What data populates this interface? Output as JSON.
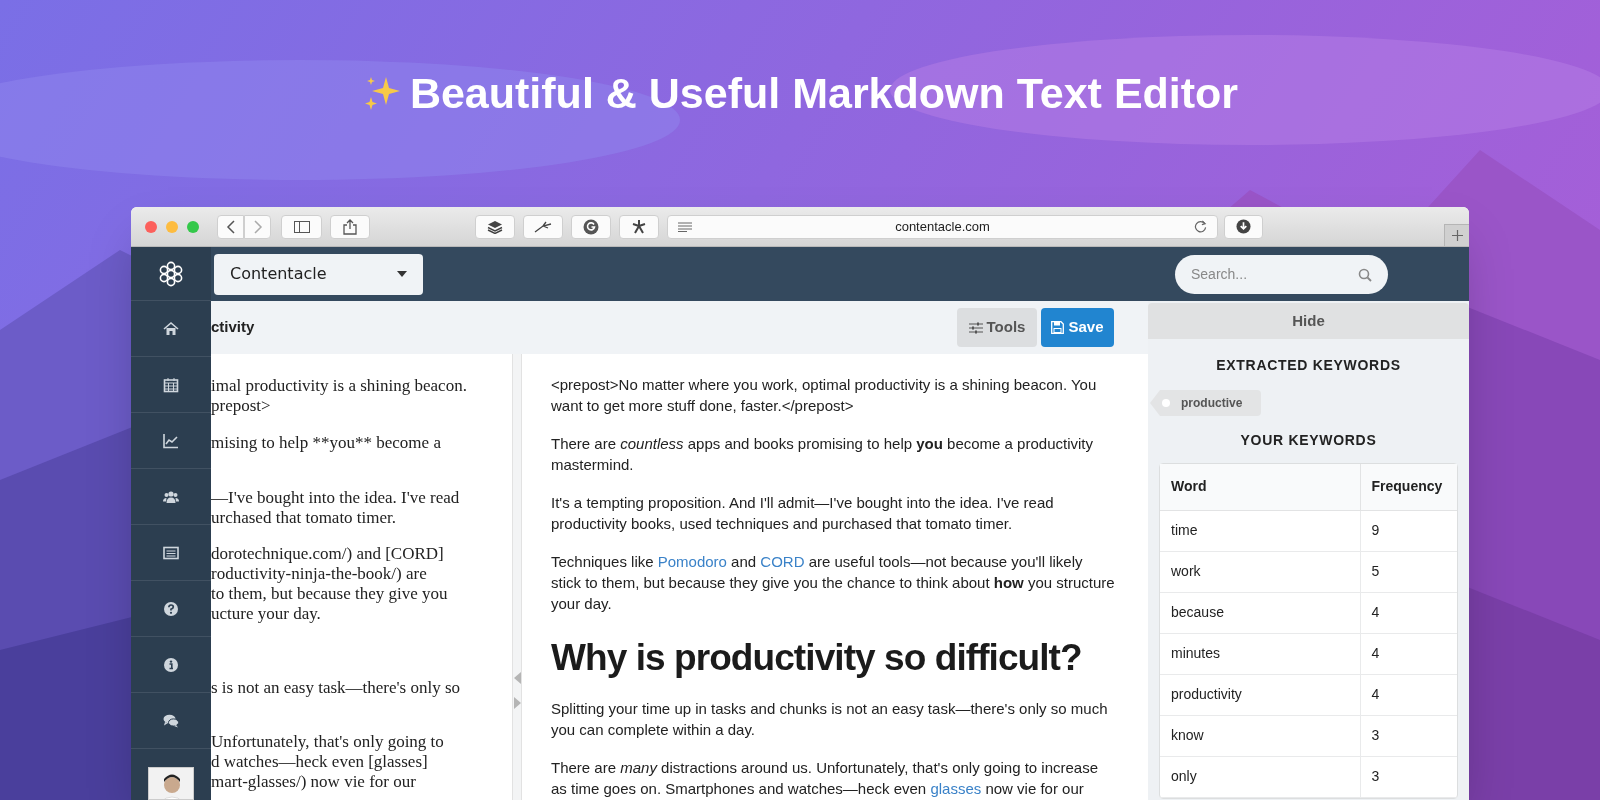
{
  "headline": "Beautiful & Useful Markdown Text Editor",
  "browser": {
    "url": "contentacle.com"
  },
  "app": {
    "workspace": "Contentacle",
    "search_placeholder": "Search...",
    "sidebar_items": [
      {
        "kind": "home"
      },
      {
        "kind": "calendar"
      },
      {
        "kind": "chart"
      },
      {
        "kind": "users"
      },
      {
        "kind": "list"
      },
      {
        "kind": "help"
      },
      {
        "kind": "info"
      },
      {
        "kind": "chat"
      }
    ],
    "document_title": "ctivity",
    "tools_button": "Tools",
    "save_button": "Save",
    "source_paragraphs": [
      [
        "imal productivity is a shining beacon.",
        "prepost>"
      ],
      [
        "mising to help **you** become a"
      ],
      [
        "—I've bought into the idea. I've read",
        "urchased that tomato timer."
      ],
      [
        "dorotechnique.com/) and [CORD]",
        "roductivity-ninja-the-book/) are",
        "to them, but because they give you",
        "ucture your day."
      ],
      [
        "s is not an easy task—there's only so"
      ],
      [
        "Unfortunately, that's only going to",
        "d watches—heck even [glasses]",
        "mart-glasses/) now vie for our"
      ]
    ],
    "preview": [
      {
        "kind": "paragraph",
        "segments": [
          {
            "kind": "text",
            "text": "<prepost>No matter where you work, optimal productivity is a shining beacon. You want to get more stuff done, faster.</prepost>"
          }
        ]
      },
      {
        "kind": "paragraph",
        "segments": [
          {
            "kind": "text",
            "text": "There are *countless* apps and books promising to help **you** become a productivity mastermind."
          }
        ]
      },
      {
        "kind": "paragraph",
        "segments": [
          {
            "kind": "text",
            "text": "It's a tempting proposition. And I'll admit—I've bought into the idea. I've read productivity books, used techniques and purchased that tomato timer."
          }
        ]
      },
      {
        "kind": "paragraph",
        "segments": [
          {
            "kind": "text",
            "text": "Techniques like "
          },
          {
            "kind": "link",
            "text": "Pomodoro"
          },
          {
            "kind": "text",
            "text": " and "
          },
          {
            "kind": "link",
            "text": "CORD"
          },
          {
            "kind": "text",
            "text": " are useful tools—not because you'll likely stick to them, but because they give you the chance to think about **how** you structure your day."
          }
        ]
      },
      {
        "kind": "heading",
        "segments": [
          {
            "kind": "text",
            "text": "Why is productivity so difficult?"
          }
        ]
      },
      {
        "kind": "paragraph",
        "segments": [
          {
            "kind": "text",
            "text": "Splitting your time up in tasks and chunks is not an easy task—there's only so much you can complete within a day."
          }
        ]
      },
      {
        "kind": "paragraph",
        "segments": [
          {
            "kind": "text",
            "text": "There are *many* distractions around us. Unfortunately, that's only going to increase as time goes on. Smartphones and watches—heck even "
          },
          {
            "kind": "link",
            "text": "glasses"
          },
          {
            "kind": "text",
            "text": " now vie for our"
          }
        ]
      }
    ],
    "keywords": {
      "hide_button": "Hide",
      "extracted_title": "EXTRACTED KEYWORDS",
      "extracted": [
        "productive"
      ],
      "your_title": "YOUR KEYWORDS",
      "columns": [
        "Word",
        "Frequency"
      ],
      "rows": [
        [
          "time",
          "9"
        ],
        [
          "work",
          "5"
        ],
        [
          "because",
          "4"
        ],
        [
          "minutes",
          "4"
        ],
        [
          "productivity",
          "4"
        ],
        [
          "know",
          "3"
        ],
        [
          "only",
          "3"
        ]
      ]
    }
  }
}
